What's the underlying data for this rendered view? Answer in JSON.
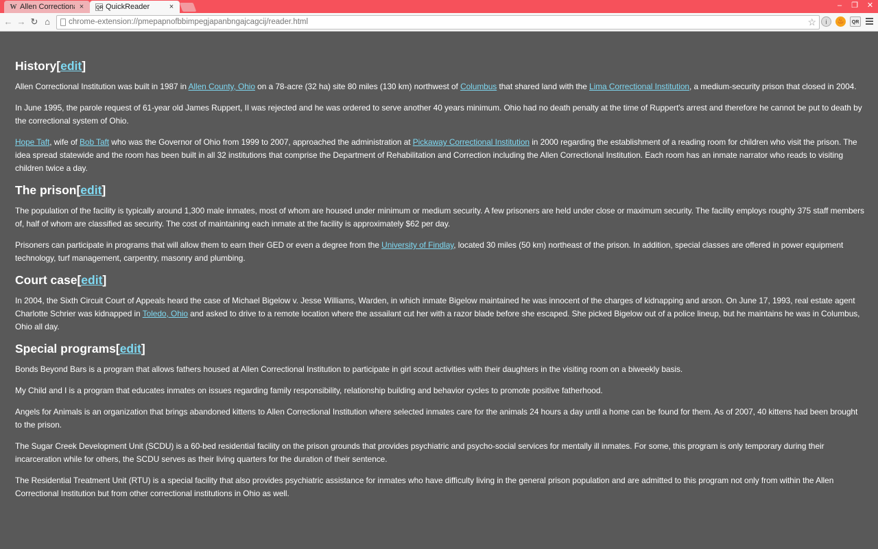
{
  "browser": {
    "tabs": [
      {
        "favicon": "W",
        "title": "Allen Correctional Institution",
        "close": "×"
      },
      {
        "favicon": "QR",
        "title": "QuickReader",
        "close": "×"
      }
    ],
    "window_controls": {
      "minimize": "–",
      "maximize": "❐",
      "close": "✕"
    },
    "url": "chrome-extension://pmepapnofbbimpegjapanbngajcagcij/reader.html",
    "extensions": {
      "ext3_label": "QR"
    },
    "icons": {
      "back": "←",
      "forward": "→",
      "reload": "↻",
      "home": "⌂",
      "star": "☆",
      "ext1": "i",
      "ext2": "♨"
    }
  },
  "article": {
    "history": {
      "heading": "History",
      "edit": "edit",
      "p1": [
        "Allen Correctional Institution was built in 1987 in ",
        "Allen County, Ohio",
        " on a 78-acre (32 ha) site 80 miles (130 km) northwest of ",
        "Columbus",
        " that shared land with the ",
        "Lima Correctional Institution",
        ", a medium-security prison that closed in 2004."
      ],
      "p2": "In June 1995, the parole request of 61-year old James Ruppert, II was rejected and he was ordered to serve another 40 years minimum. Ohio had no death penalty at the time of Ruppert's arrest and therefore he cannot be put to death by the correctional system of Ohio.",
      "p3": [
        "Hope Taft",
        ", wife of ",
        "Bob Taft",
        " who was the Governor of Ohio from 1999 to 2007, approached the administration at ",
        "Pickaway Correctional Institution",
        " in 2000 regarding the establishment of a reading room for children who visit the prison. The idea spread statewide and the room has been built in all 32 institutions that comprise the Department of Rehabilitation and Correction including the Allen Correctional Institution. Each room has an inmate narrator who reads to visiting children twice a day."
      ]
    },
    "prison": {
      "heading": "The prison",
      "edit": "edit",
      "p1": "The population of the facility is typically around 1,300 male inmates, most of whom are housed under minimum or medium security. A few prisoners are held under close or maximum security. The facility employs roughly 375 staff members of, half of whom are classified as security. The cost of maintaining each inmate at the facility is approximately $62 per day.",
      "p2": [
        "Prisoners can participate in programs that will allow them to earn their GED or even a degree from the ",
        "University of Findlay",
        ", located 30 miles (50 km) northeast of the prison. In addition, special classes are offered in power equipment technology, turf management, carpentry, masonry and plumbing."
      ]
    },
    "court": {
      "heading": "Court case",
      "edit": "edit",
      "p1": [
        "In 2004, the Sixth Circuit Court of Appeals heard the case of Michael Bigelow v. Jesse Williams, Warden, in which inmate Bigelow maintained he was innocent of the charges of kidnapping and arson. On June 17, 1993, real estate agent Charlotte Schrier was kidnapped in ",
        "Toledo, Ohio",
        " and asked to drive to a remote location where the assailant cut her with a razor blade before she escaped. She picked Bigelow out of a police lineup, but he maintains he was in Columbus, Ohio all day."
      ]
    },
    "special": {
      "heading": "Special programs",
      "edit": "edit",
      "p1": "Bonds Beyond Bars is a program that allows fathers housed at Allen Correctional Institution to participate in girl scout activities with their daughters in the visiting room on a biweekly basis.",
      "p2": "My Child and I is a program that educates inmates on issues regarding family responsibility, relationship building and behavior cycles to promote positive fatherhood.",
      "p3": "Angels for Animals is an organization that brings abandoned kittens to Allen Correctional Institution where selected inmates care for the animals 24 hours a day until a home can be found for them. As of 2007, 40 kittens had been brought to the prison.",
      "p4": "The Sugar Creek Development Unit (SCDU) is a 60-bed residential facility on the prison grounds that provides psychiatric and psycho-social services for mentally ill inmates. For some, this program is only temporary during their incarceration while for others, the SCDU serves as their living quarters for the duration of their sentence.",
      "p5": "The Residential Treatment Unit (RTU) is a special facility that also provides psychiatric assistance for inmates who have difficulty living in the general prison population and are admitted to this program not only from within the Allen Correctional Institution but from other correctional institutions in Ohio as well."
    }
  },
  "colors": {
    "background": "#595959",
    "link": "#7fd9f2",
    "titlebar": "#f6515b"
  }
}
